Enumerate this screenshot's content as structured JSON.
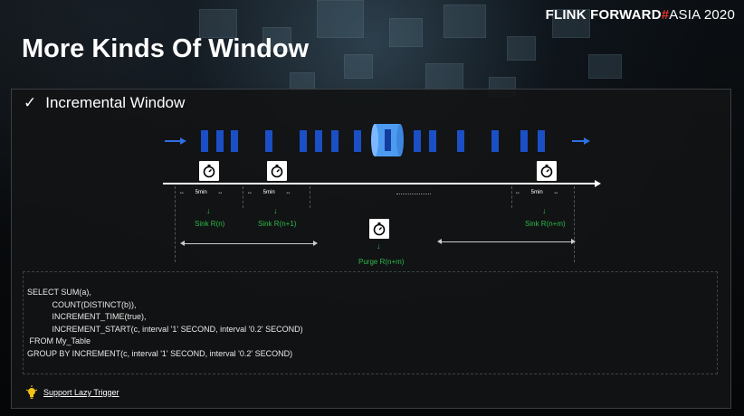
{
  "brand": {
    "part1": "FLINK FORWARD",
    "hash": "#",
    "part2": "ASIA 2020"
  },
  "slide": {
    "title": "More Kinds Of Window",
    "subheading": "Incremental Window",
    "check_glyph": "✓"
  },
  "diagram": {
    "segment_labels": [
      "5min",
      "5min",
      "5min"
    ],
    "sink_labels": [
      "Sink R(n)",
      "Sink R(n+1)",
      "Sink R(n+m)"
    ],
    "purge_label": "Purge R(n+m)",
    "timer_icon": "stopwatch-icon",
    "stream_color": "#1a4fc6",
    "sink_color": "#2dbb4c"
  },
  "code": {
    "lines": [
      "SELECT SUM(a),",
      "           COUNT(DISTINCT(b)),",
      "           INCREMENT_TIME(true),",
      "           INCREMENT_START(c, interval '1' SECOND, interval '0.2' SECOND)",
      " FROM My_Table",
      "GROUP BY INCREMENT(c, interval '1' SECOND, interval '0.2' SECOND)"
    ]
  },
  "footer": {
    "lazy_trigger_label": "Support Lazy Trigger",
    "icon": "lightbulb-icon"
  }
}
